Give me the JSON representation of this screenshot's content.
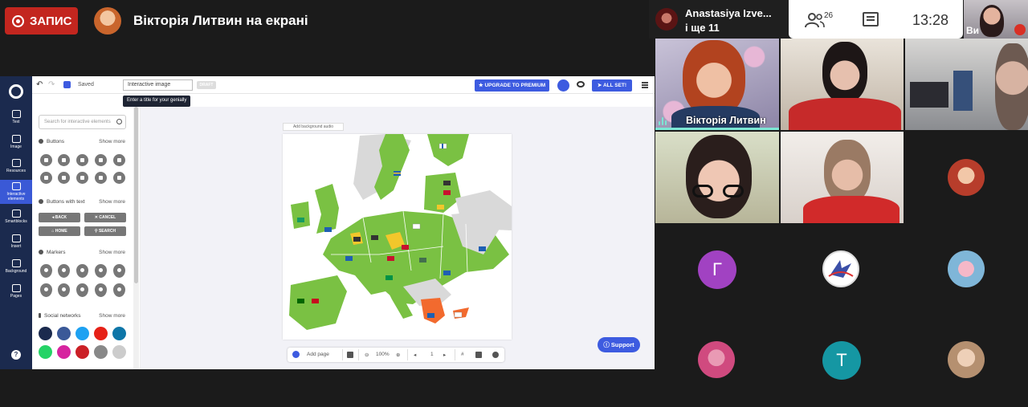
{
  "meeting": {
    "record_label": "ЗАПИС",
    "presenter_title": "Вікторія Литвин на екрані",
    "active_speaker": "Anastasiya Izve...",
    "active_speaker_more": "і ще 11",
    "participants_count": "26",
    "time": "13:28",
    "self_label": "Ви"
  },
  "editor": {
    "saved_label": "Saved",
    "title_value": "Interactive image",
    "draft_badge": "DRAFT",
    "title_tooltip": "Enter a title for your genially",
    "premium_button": "UPGRADE TO PREMIUM",
    "all_set_button": "ALL SET!",
    "left_nav": [
      {
        "label": "Text",
        "icon": "text-icon"
      },
      {
        "label": "Image",
        "icon": "image-icon"
      },
      {
        "label": "Resources",
        "icon": "resources-icon"
      },
      {
        "label": "Interactive elements",
        "icon": "interactive-icon"
      },
      {
        "label": "Smartblocks",
        "icon": "smartblocks-icon"
      },
      {
        "label": "Insert",
        "icon": "insert-icon"
      },
      {
        "label": "Background",
        "icon": "background-icon"
      },
      {
        "label": "Pages",
        "icon": "pages-icon"
      }
    ],
    "search_placeholder": "Search for interactive elements",
    "sections": {
      "buttons": "Buttons",
      "buttons_text": "Buttons with text",
      "markers": "Markers",
      "social": "Social networks",
      "show_more": "Show more"
    },
    "text_buttons": [
      "BACK",
      "CANCEL",
      "HOME",
      "SEARCH"
    ],
    "add_bg_audio": "Add background audio",
    "add_page": "Add page",
    "zoom": "100%",
    "page_number": "1",
    "support": "Support",
    "colors": {
      "accent": "#3d5be0",
      "nav": "#1b2a4e",
      "map_green": "#7ac143",
      "map_gray": "#d9d9d9",
      "map_yellow": "#f2c72b",
      "map_orange": "#f26a2e"
    }
  },
  "tiles": {
    "presenter_name": "Вікторія Литвин",
    "letter_g": "Г",
    "letter_t": "Т"
  }
}
